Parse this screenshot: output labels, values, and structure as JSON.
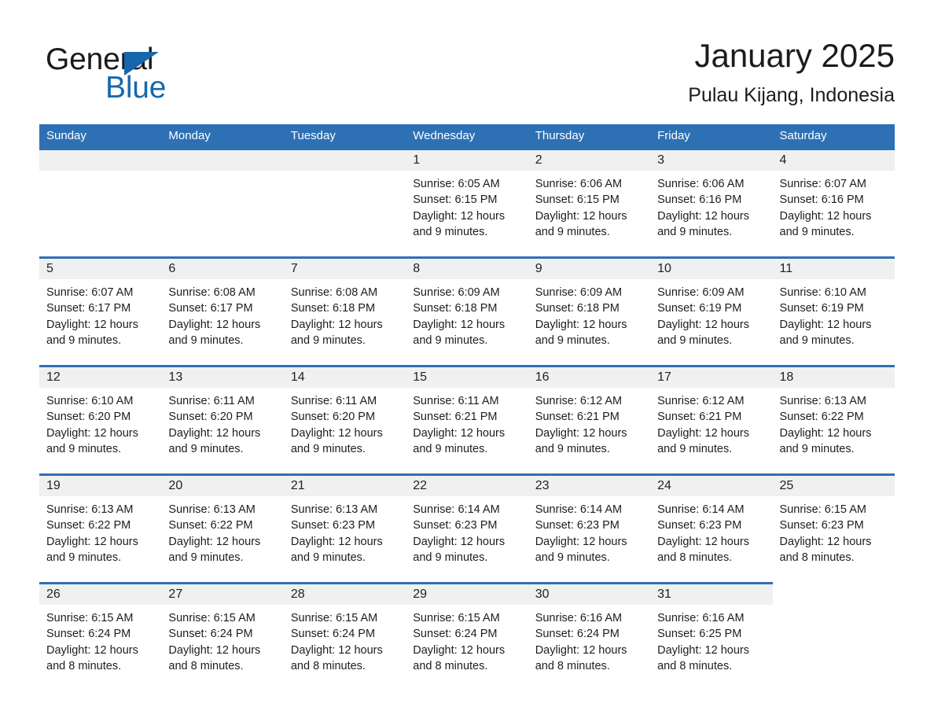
{
  "brand": {
    "name_line1": "General",
    "name_line2": "Blue",
    "black": "#1a1a1a",
    "blue": "#1668ad"
  },
  "header": {
    "month_title": "January 2025",
    "location": "Pulau Kijang, Indonesia"
  },
  "colors": {
    "header_blue": "#2e70b4",
    "rule_blue": "#2e70b4",
    "daynum_band": "#f0f0f0",
    "text": "#1d1d1d"
  },
  "weekdays": [
    "Sunday",
    "Monday",
    "Tuesday",
    "Wednesday",
    "Thursday",
    "Friday",
    "Saturday"
  ],
  "weeks": [
    {
      "days": [
        {
          "date": "",
          "sunrise": "",
          "sunset": "",
          "daylight_line1": "",
          "daylight_line2": ""
        },
        {
          "date": "",
          "sunrise": "",
          "sunset": "",
          "daylight_line1": "",
          "daylight_line2": ""
        },
        {
          "date": "",
          "sunrise": "",
          "sunset": "",
          "daylight_line1": "",
          "daylight_line2": ""
        },
        {
          "date": "1",
          "sunrise": "Sunrise: 6:05 AM",
          "sunset": "Sunset: 6:15 PM",
          "daylight_line1": "Daylight: 12 hours",
          "daylight_line2": "and 9 minutes."
        },
        {
          "date": "2",
          "sunrise": "Sunrise: 6:06 AM",
          "sunset": "Sunset: 6:15 PM",
          "daylight_line1": "Daylight: 12 hours",
          "daylight_line2": "and 9 minutes."
        },
        {
          "date": "3",
          "sunrise": "Sunrise: 6:06 AM",
          "sunset": "Sunset: 6:16 PM",
          "daylight_line1": "Daylight: 12 hours",
          "daylight_line2": "and 9 minutes."
        },
        {
          "date": "4",
          "sunrise": "Sunrise: 6:07 AM",
          "sunset": "Sunset: 6:16 PM",
          "daylight_line1": "Daylight: 12 hours",
          "daylight_line2": "and 9 minutes."
        }
      ]
    },
    {
      "days": [
        {
          "date": "5",
          "sunrise": "Sunrise: 6:07 AM",
          "sunset": "Sunset: 6:17 PM",
          "daylight_line1": "Daylight: 12 hours",
          "daylight_line2": "and 9 minutes."
        },
        {
          "date": "6",
          "sunrise": "Sunrise: 6:08 AM",
          "sunset": "Sunset: 6:17 PM",
          "daylight_line1": "Daylight: 12 hours",
          "daylight_line2": "and 9 minutes."
        },
        {
          "date": "7",
          "sunrise": "Sunrise: 6:08 AM",
          "sunset": "Sunset: 6:18 PM",
          "daylight_line1": "Daylight: 12 hours",
          "daylight_line2": "and 9 minutes."
        },
        {
          "date": "8",
          "sunrise": "Sunrise: 6:09 AM",
          "sunset": "Sunset: 6:18 PM",
          "daylight_line1": "Daylight: 12 hours",
          "daylight_line2": "and 9 minutes."
        },
        {
          "date": "9",
          "sunrise": "Sunrise: 6:09 AM",
          "sunset": "Sunset: 6:18 PM",
          "daylight_line1": "Daylight: 12 hours",
          "daylight_line2": "and 9 minutes."
        },
        {
          "date": "10",
          "sunrise": "Sunrise: 6:09 AM",
          "sunset": "Sunset: 6:19 PM",
          "daylight_line1": "Daylight: 12 hours",
          "daylight_line2": "and 9 minutes."
        },
        {
          "date": "11",
          "sunrise": "Sunrise: 6:10 AM",
          "sunset": "Sunset: 6:19 PM",
          "daylight_line1": "Daylight: 12 hours",
          "daylight_line2": "and 9 minutes."
        }
      ]
    },
    {
      "days": [
        {
          "date": "12",
          "sunrise": "Sunrise: 6:10 AM",
          "sunset": "Sunset: 6:20 PM",
          "daylight_line1": "Daylight: 12 hours",
          "daylight_line2": "and 9 minutes."
        },
        {
          "date": "13",
          "sunrise": "Sunrise: 6:11 AM",
          "sunset": "Sunset: 6:20 PM",
          "daylight_line1": "Daylight: 12 hours",
          "daylight_line2": "and 9 minutes."
        },
        {
          "date": "14",
          "sunrise": "Sunrise: 6:11 AM",
          "sunset": "Sunset: 6:20 PM",
          "daylight_line1": "Daylight: 12 hours",
          "daylight_line2": "and 9 minutes."
        },
        {
          "date": "15",
          "sunrise": "Sunrise: 6:11 AM",
          "sunset": "Sunset: 6:21 PM",
          "daylight_line1": "Daylight: 12 hours",
          "daylight_line2": "and 9 minutes."
        },
        {
          "date": "16",
          "sunrise": "Sunrise: 6:12 AM",
          "sunset": "Sunset: 6:21 PM",
          "daylight_line1": "Daylight: 12 hours",
          "daylight_line2": "and 9 minutes."
        },
        {
          "date": "17",
          "sunrise": "Sunrise: 6:12 AM",
          "sunset": "Sunset: 6:21 PM",
          "daylight_line1": "Daylight: 12 hours",
          "daylight_line2": "and 9 minutes."
        },
        {
          "date": "18",
          "sunrise": "Sunrise: 6:13 AM",
          "sunset": "Sunset: 6:22 PM",
          "daylight_line1": "Daylight: 12 hours",
          "daylight_line2": "and 9 minutes."
        }
      ]
    },
    {
      "days": [
        {
          "date": "19",
          "sunrise": "Sunrise: 6:13 AM",
          "sunset": "Sunset: 6:22 PM",
          "daylight_line1": "Daylight: 12 hours",
          "daylight_line2": "and 9 minutes."
        },
        {
          "date": "20",
          "sunrise": "Sunrise: 6:13 AM",
          "sunset": "Sunset: 6:22 PM",
          "daylight_line1": "Daylight: 12 hours",
          "daylight_line2": "and 9 minutes."
        },
        {
          "date": "21",
          "sunrise": "Sunrise: 6:13 AM",
          "sunset": "Sunset: 6:23 PM",
          "daylight_line1": "Daylight: 12 hours",
          "daylight_line2": "and 9 minutes."
        },
        {
          "date": "22",
          "sunrise": "Sunrise: 6:14 AM",
          "sunset": "Sunset: 6:23 PM",
          "daylight_line1": "Daylight: 12 hours",
          "daylight_line2": "and 9 minutes."
        },
        {
          "date": "23",
          "sunrise": "Sunrise: 6:14 AM",
          "sunset": "Sunset: 6:23 PM",
          "daylight_line1": "Daylight: 12 hours",
          "daylight_line2": "and 9 minutes."
        },
        {
          "date": "24",
          "sunrise": "Sunrise: 6:14 AM",
          "sunset": "Sunset: 6:23 PM",
          "daylight_line1": "Daylight: 12 hours",
          "daylight_line2": "and 8 minutes."
        },
        {
          "date": "25",
          "sunrise": "Sunrise: 6:15 AM",
          "sunset": "Sunset: 6:23 PM",
          "daylight_line1": "Daylight: 12 hours",
          "daylight_line2": "and 8 minutes."
        }
      ]
    },
    {
      "partial": true,
      "days": [
        {
          "date": "26",
          "sunrise": "Sunrise: 6:15 AM",
          "sunset": "Sunset: 6:24 PM",
          "daylight_line1": "Daylight: 12 hours",
          "daylight_line2": "and 8 minutes."
        },
        {
          "date": "27",
          "sunrise": "Sunrise: 6:15 AM",
          "sunset": "Sunset: 6:24 PM",
          "daylight_line1": "Daylight: 12 hours",
          "daylight_line2": "and 8 minutes."
        },
        {
          "date": "28",
          "sunrise": "Sunrise: 6:15 AM",
          "sunset": "Sunset: 6:24 PM",
          "daylight_line1": "Daylight: 12 hours",
          "daylight_line2": "and 8 minutes."
        },
        {
          "date": "29",
          "sunrise": "Sunrise: 6:15 AM",
          "sunset": "Sunset: 6:24 PM",
          "daylight_line1": "Daylight: 12 hours",
          "daylight_line2": "and 8 minutes."
        },
        {
          "date": "30",
          "sunrise": "Sunrise: 6:16 AM",
          "sunset": "Sunset: 6:24 PM",
          "daylight_line1": "Daylight: 12 hours",
          "daylight_line2": "and 8 minutes."
        },
        {
          "date": "31",
          "sunrise": "Sunrise: 6:16 AM",
          "sunset": "Sunset: 6:25 PM",
          "daylight_line1": "Daylight: 12 hours",
          "daylight_line2": "and 8 minutes."
        },
        {
          "date": "",
          "sunrise": "",
          "sunset": "",
          "daylight_line1": "",
          "daylight_line2": ""
        }
      ]
    }
  ]
}
